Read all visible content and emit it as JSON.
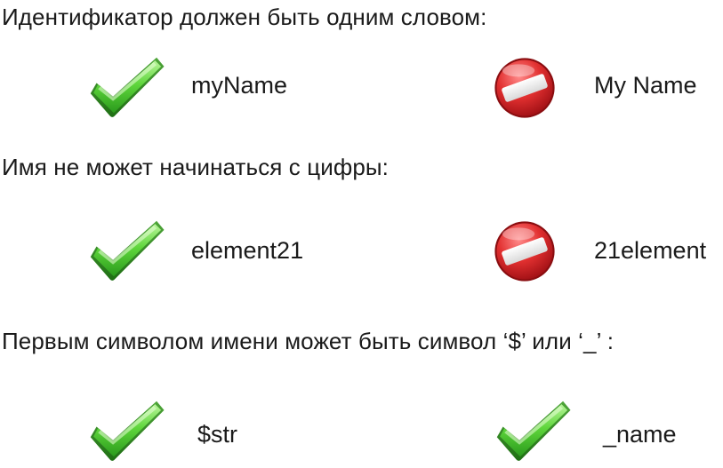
{
  "sections": [
    {
      "heading": "Идентификатор должен быть одним словом:",
      "left": {
        "icon": "check-icon",
        "text": "myName"
      },
      "right": {
        "icon": "forbidden-icon",
        "text": "My Name"
      }
    },
    {
      "heading": "Имя не может начинаться с цифры:",
      "left": {
        "icon": "check-icon",
        "text": "element21"
      },
      "right": {
        "icon": "forbidden-icon",
        "text": "21element"
      }
    },
    {
      "heading": "Первым символом имени может быть символ ‘$’ или ‘_’ :",
      "left": {
        "icon": "check-icon",
        "text": "$str"
      },
      "right": {
        "icon": "check-icon",
        "text": "_name"
      }
    }
  ],
  "colors": {
    "check_green": "#3fbf2a",
    "forbidden_red": "#d8242a"
  }
}
